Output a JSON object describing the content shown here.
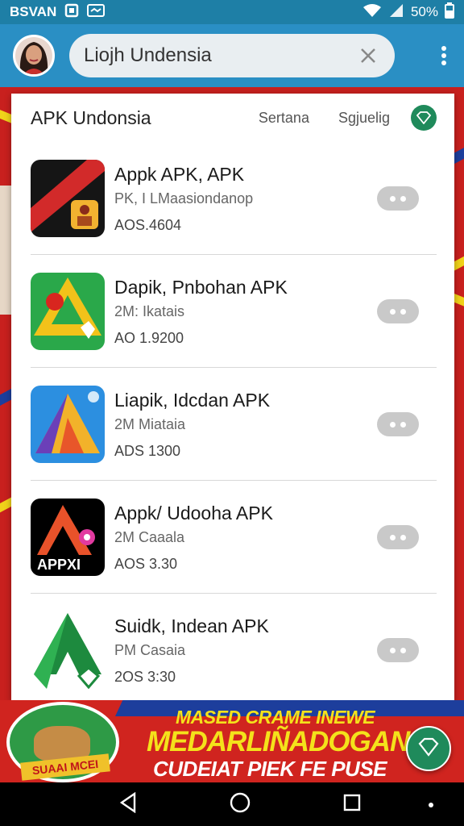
{
  "status_bar": {
    "carrier": "BSVAN",
    "battery": "50%",
    "icons": [
      "app-notification-icon",
      "message-icon",
      "wifi-icon",
      "signal-icon",
      "battery-icon"
    ]
  },
  "search": {
    "query": "Liojh Undensia",
    "icons": [
      "avatar",
      "clear-icon",
      "more-vert-icon"
    ]
  },
  "panel": {
    "title": "APK Undonsia",
    "tabs": [
      "Sertana",
      "Sgjuelig"
    ],
    "badge_icon": "diamond-icon",
    "apps": [
      {
        "name": "Appk APK, APK",
        "sub": "PK, I LMaasiondanop",
        "size": "AOS.4604",
        "icon": "appk-icon",
        "colors": [
          "#111111",
          "#d22a2a",
          "#f2b230"
        ]
      },
      {
        "name": "Dapik, Pnbohan APK",
        "sub": "2M: Ikatais",
        "size": "AO 1.9200",
        "icon": "dapik-icon",
        "colors": [
          "#2aa84a",
          "#f2c21a",
          "#d8261f"
        ]
      },
      {
        "name": "Liapik, Idcdan APK",
        "sub": "2M Miataia",
        "size": "ADS 1300",
        "icon": "liapik-icon",
        "colors": [
          "#2c8fe0",
          "#f2b22a",
          "#6b3fb8"
        ]
      },
      {
        "name": "Appk/ Udooha APK",
        "sub": "2M Caaala",
        "size": "AOS 3.30",
        "icon": "appxi-icon",
        "colors": [
          "#000000",
          "#e8522a",
          "#e23aa0"
        ]
      },
      {
        "name": "Suidk, Indean APK",
        "sub": "PM Casaia",
        "size": "2OS 3:30",
        "icon": "suidk-icon",
        "colors": [
          "#1d8a3e",
          "#2fb152",
          "#ffffff"
        ]
      }
    ],
    "row_action_icon": "more-horiz-icon"
  },
  "banner": {
    "line1": "MASED CRAME INEWE",
    "line2": "MEDARLIÑADOGAN",
    "line3": "CUDEIAT PIEK FE PUSE",
    "mascot_label": "SUAAI MCEI"
  },
  "fab_icon": "diamond-icon",
  "nav_bar": {
    "icons": [
      "back-icon",
      "home-icon",
      "recents-icon"
    ]
  }
}
